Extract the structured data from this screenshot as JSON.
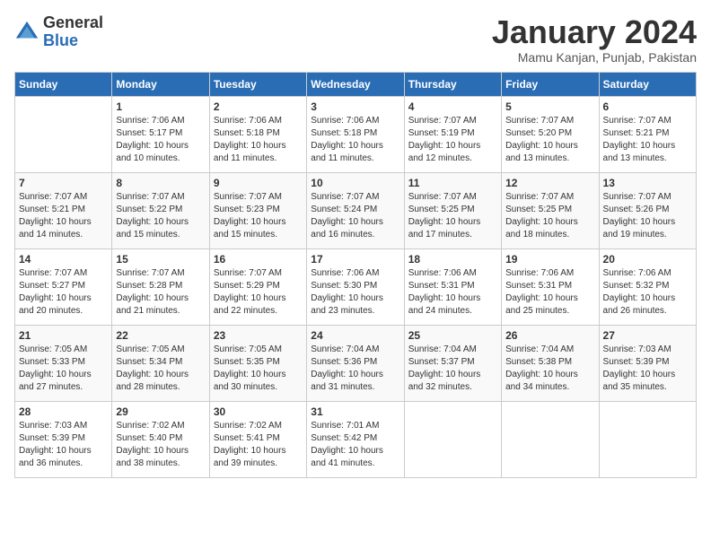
{
  "app": {
    "logo_general": "General",
    "logo_blue": "Blue"
  },
  "header": {
    "month": "January 2024",
    "location": "Mamu Kanjan, Punjab, Pakistan"
  },
  "weekdays": [
    "Sunday",
    "Monday",
    "Tuesday",
    "Wednesday",
    "Thursday",
    "Friday",
    "Saturday"
  ],
  "weeks": [
    [
      {
        "day": "",
        "sunrise": "",
        "sunset": "",
        "daylight": ""
      },
      {
        "day": "1",
        "sunrise": "Sunrise: 7:06 AM",
        "sunset": "Sunset: 5:17 PM",
        "daylight": "Daylight: 10 hours and 10 minutes."
      },
      {
        "day": "2",
        "sunrise": "Sunrise: 7:06 AM",
        "sunset": "Sunset: 5:18 PM",
        "daylight": "Daylight: 10 hours and 11 minutes."
      },
      {
        "day": "3",
        "sunrise": "Sunrise: 7:06 AM",
        "sunset": "Sunset: 5:18 PM",
        "daylight": "Daylight: 10 hours and 11 minutes."
      },
      {
        "day": "4",
        "sunrise": "Sunrise: 7:07 AM",
        "sunset": "Sunset: 5:19 PM",
        "daylight": "Daylight: 10 hours and 12 minutes."
      },
      {
        "day": "5",
        "sunrise": "Sunrise: 7:07 AM",
        "sunset": "Sunset: 5:20 PM",
        "daylight": "Daylight: 10 hours and 13 minutes."
      },
      {
        "day": "6",
        "sunrise": "Sunrise: 7:07 AM",
        "sunset": "Sunset: 5:21 PM",
        "daylight": "Daylight: 10 hours and 13 minutes."
      }
    ],
    [
      {
        "day": "7",
        "sunrise": "Sunrise: 7:07 AM",
        "sunset": "Sunset: 5:21 PM",
        "daylight": "Daylight: 10 hours and 14 minutes."
      },
      {
        "day": "8",
        "sunrise": "Sunrise: 7:07 AM",
        "sunset": "Sunset: 5:22 PM",
        "daylight": "Daylight: 10 hours and 15 minutes."
      },
      {
        "day": "9",
        "sunrise": "Sunrise: 7:07 AM",
        "sunset": "Sunset: 5:23 PM",
        "daylight": "Daylight: 10 hours and 15 minutes."
      },
      {
        "day": "10",
        "sunrise": "Sunrise: 7:07 AM",
        "sunset": "Sunset: 5:24 PM",
        "daylight": "Daylight: 10 hours and 16 minutes."
      },
      {
        "day": "11",
        "sunrise": "Sunrise: 7:07 AM",
        "sunset": "Sunset: 5:25 PM",
        "daylight": "Daylight: 10 hours and 17 minutes."
      },
      {
        "day": "12",
        "sunrise": "Sunrise: 7:07 AM",
        "sunset": "Sunset: 5:25 PM",
        "daylight": "Daylight: 10 hours and 18 minutes."
      },
      {
        "day": "13",
        "sunrise": "Sunrise: 7:07 AM",
        "sunset": "Sunset: 5:26 PM",
        "daylight": "Daylight: 10 hours and 19 minutes."
      }
    ],
    [
      {
        "day": "14",
        "sunrise": "Sunrise: 7:07 AM",
        "sunset": "Sunset: 5:27 PM",
        "daylight": "Daylight: 10 hours and 20 minutes."
      },
      {
        "day": "15",
        "sunrise": "Sunrise: 7:07 AM",
        "sunset": "Sunset: 5:28 PM",
        "daylight": "Daylight: 10 hours and 21 minutes."
      },
      {
        "day": "16",
        "sunrise": "Sunrise: 7:07 AM",
        "sunset": "Sunset: 5:29 PM",
        "daylight": "Daylight: 10 hours and 22 minutes."
      },
      {
        "day": "17",
        "sunrise": "Sunrise: 7:06 AM",
        "sunset": "Sunset: 5:30 PM",
        "daylight": "Daylight: 10 hours and 23 minutes."
      },
      {
        "day": "18",
        "sunrise": "Sunrise: 7:06 AM",
        "sunset": "Sunset: 5:31 PM",
        "daylight": "Daylight: 10 hours and 24 minutes."
      },
      {
        "day": "19",
        "sunrise": "Sunrise: 7:06 AM",
        "sunset": "Sunset: 5:31 PM",
        "daylight": "Daylight: 10 hours and 25 minutes."
      },
      {
        "day": "20",
        "sunrise": "Sunrise: 7:06 AM",
        "sunset": "Sunset: 5:32 PM",
        "daylight": "Daylight: 10 hours and 26 minutes."
      }
    ],
    [
      {
        "day": "21",
        "sunrise": "Sunrise: 7:05 AM",
        "sunset": "Sunset: 5:33 PM",
        "daylight": "Daylight: 10 hours and 27 minutes."
      },
      {
        "day": "22",
        "sunrise": "Sunrise: 7:05 AM",
        "sunset": "Sunset: 5:34 PM",
        "daylight": "Daylight: 10 hours and 28 minutes."
      },
      {
        "day": "23",
        "sunrise": "Sunrise: 7:05 AM",
        "sunset": "Sunset: 5:35 PM",
        "daylight": "Daylight: 10 hours and 30 minutes."
      },
      {
        "day": "24",
        "sunrise": "Sunrise: 7:04 AM",
        "sunset": "Sunset: 5:36 PM",
        "daylight": "Daylight: 10 hours and 31 minutes."
      },
      {
        "day": "25",
        "sunrise": "Sunrise: 7:04 AM",
        "sunset": "Sunset: 5:37 PM",
        "daylight": "Daylight: 10 hours and 32 minutes."
      },
      {
        "day": "26",
        "sunrise": "Sunrise: 7:04 AM",
        "sunset": "Sunset: 5:38 PM",
        "daylight": "Daylight: 10 hours and 34 minutes."
      },
      {
        "day": "27",
        "sunrise": "Sunrise: 7:03 AM",
        "sunset": "Sunset: 5:39 PM",
        "daylight": "Daylight: 10 hours and 35 minutes."
      }
    ],
    [
      {
        "day": "28",
        "sunrise": "Sunrise: 7:03 AM",
        "sunset": "Sunset: 5:39 PM",
        "daylight": "Daylight: 10 hours and 36 minutes."
      },
      {
        "day": "29",
        "sunrise": "Sunrise: 7:02 AM",
        "sunset": "Sunset: 5:40 PM",
        "daylight": "Daylight: 10 hours and 38 minutes."
      },
      {
        "day": "30",
        "sunrise": "Sunrise: 7:02 AM",
        "sunset": "Sunset: 5:41 PM",
        "daylight": "Daylight: 10 hours and 39 minutes."
      },
      {
        "day": "31",
        "sunrise": "Sunrise: 7:01 AM",
        "sunset": "Sunset: 5:42 PM",
        "daylight": "Daylight: 10 hours and 41 minutes."
      },
      {
        "day": "",
        "sunrise": "",
        "sunset": "",
        "daylight": ""
      },
      {
        "day": "",
        "sunrise": "",
        "sunset": "",
        "daylight": ""
      },
      {
        "day": "",
        "sunrise": "",
        "sunset": "",
        "daylight": ""
      }
    ]
  ]
}
